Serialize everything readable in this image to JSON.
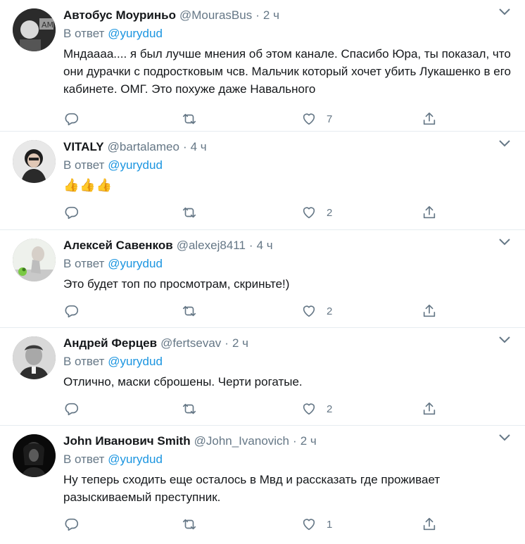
{
  "tweets": [
    {
      "name": "Автобус Моуриньо",
      "handle": "@MourasBus",
      "time": "2 ч",
      "reply_prefix": "В ответ",
      "reply_to": "@yurydud",
      "text": "Мндаааа.... я был лучше мнения об этом канале. Спасибо Юра, ты показал, что они дурачки с подростковым чсв. Мальчик который хочет убить Лукашенко в его кабинете. ОМГ. Это похуже даже Навального",
      "likes": "7"
    },
    {
      "name": "VITALY",
      "handle": "@bartalameo",
      "time": "4 ч",
      "reply_prefix": "В ответ",
      "reply_to": "@yurydud",
      "text": "👍👍👍",
      "likes": "2"
    },
    {
      "name": "Алексей Савенков",
      "handle": "@alexej8411",
      "time": "4 ч",
      "reply_prefix": "В ответ",
      "reply_to": "@yurydud",
      "text": "Это будет топ по просмотрам, скриньте!)",
      "likes": "2"
    },
    {
      "name": "Андрей Ферцев",
      "handle": "@fertsevav",
      "time": "2 ч",
      "reply_prefix": "В ответ",
      "reply_to": "@yurydud",
      "text": "Отлично, маски сброшены. Черти рогатые.",
      "likes": "2"
    },
    {
      "name": "John Иванович Smith",
      "handle": "@John_Ivanovich",
      "time": "2 ч",
      "reply_prefix": "В ответ",
      "reply_to": "@yurydud",
      "text": "Ну теперь сходить еще осталось в Мвд и рассказать где проживает разыскиваемый преступник.",
      "likes": "1"
    }
  ],
  "separator": "·",
  "icons": {
    "reply": "reply-icon",
    "retweet": "retweet-icon",
    "like": "heart-icon",
    "share": "share-icon",
    "menu": "chevron-down-icon"
  },
  "colors": {
    "link": "#1b95e0",
    "muted": "#657786",
    "text": "#14171a",
    "divider": "#e6ecf0"
  }
}
